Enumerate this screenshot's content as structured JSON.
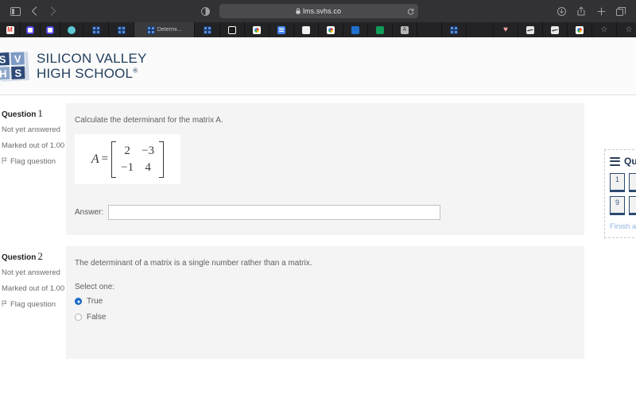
{
  "browser": {
    "url": "lms.svhs.co",
    "lock_icon": "lock-icon",
    "reload_icon": "reload-icon",
    "nav": {
      "sidebar_icon": "sidebar-toggle-icon",
      "back_icon": "back-arrow-icon",
      "forward_icon": "forward-arrow-icon",
      "reader_icon": "reader-view-icon"
    },
    "actions": {
      "downloads_icon": "downloads-icon",
      "share_icon": "share-icon",
      "new_tab_icon": "plus-icon",
      "tab_overview_icon": "tab-overview-icon"
    },
    "active_tab_label": "Determi...",
    "tabs": [
      {
        "favicon": "gmail-icon",
        "label": ""
      },
      {
        "favicon": "blue-ring-icon",
        "label": ""
      },
      {
        "favicon": "blue-ring-icon",
        "label": ""
      },
      {
        "favicon": "teal-circle-icon",
        "label": ""
      },
      {
        "favicon": "blue-grid-icon",
        "label": ""
      },
      {
        "favicon": "blue-grid-icon",
        "label": ""
      },
      {
        "favicon": "blue-grid-icon",
        "label": "Determi..."
      },
      {
        "favicon": "blue-grid-icon",
        "label": ""
      },
      {
        "favicon": "dark-square-icon",
        "label": ""
      },
      {
        "favicon": "chrome-icon",
        "label": ""
      },
      {
        "favicon": "google-docs-icon",
        "label": ""
      },
      {
        "favicon": "white-square-icon",
        "label": ""
      },
      {
        "favicon": "chrome-icon",
        "label": ""
      },
      {
        "favicon": "camera-icon",
        "label": ""
      },
      {
        "favicon": "green-globe-icon",
        "label": ""
      },
      {
        "favicon": "letter-a-icon",
        "label": ""
      },
      {
        "favicon": "empty-icon",
        "label": ""
      },
      {
        "favicon": "blue-grid-icon",
        "label": ""
      },
      {
        "favicon": "empty-icon",
        "label": ""
      },
      {
        "favicon": "heart-icon",
        "label": ""
      },
      {
        "favicon": "nike-icon",
        "label": ""
      },
      {
        "favicon": "nike-icon",
        "label": ""
      },
      {
        "favicon": "chrome-icon",
        "label": ""
      },
      {
        "favicon": "star-icon",
        "label": ""
      },
      {
        "favicon": "star-icon",
        "label": ""
      },
      {
        "favicon": "green-box-icon",
        "label": ""
      }
    ]
  },
  "site": {
    "logo_cells": [
      "S",
      "V",
      "H",
      "S"
    ],
    "logo_line1": "SILICON VALLEY",
    "logo_line2": "HIGH SCHOOL",
    "logo_registered": "®"
  },
  "questions": [
    {
      "title_label": "Question",
      "number": "1",
      "status": "Not yet answered",
      "marks": "Marked out of 1.00",
      "flag_label": "Flag question",
      "flag_icon": "flag-icon",
      "prompt": "Calculate the determinant for the matrix A.",
      "matrix": {
        "name": "A",
        "equals": "=",
        "rows": [
          [
            "2",
            "−3"
          ],
          [
            "−1",
            "4"
          ]
        ]
      },
      "answer_label": "Answer:",
      "answer_value": "",
      "answer_placeholder": ""
    },
    {
      "title_label": "Question",
      "number": "2",
      "status": "Not yet answered",
      "marks": "Marked out of 1.00",
      "flag_label": "Flag question",
      "flag_icon": "flag-icon",
      "prompt": "The determinant of a matrix is a single number rather than a matrix.",
      "select_one": "Select one:",
      "options": [
        {
          "label": "True",
          "selected": true
        },
        {
          "label": "False",
          "selected": false
        }
      ]
    }
  ],
  "quiz_nav": {
    "menu_icon": "hamburger-icon",
    "title": "Qu",
    "buttons": [
      "1",
      "9"
    ],
    "finish_label": "Finish a"
  },
  "colors": {
    "accent_navy": "#2e4a78",
    "radio_selected": "#1a6fd4",
    "panel_bg": "#f4f4f4",
    "link_blue": "#8fb4dd"
  }
}
